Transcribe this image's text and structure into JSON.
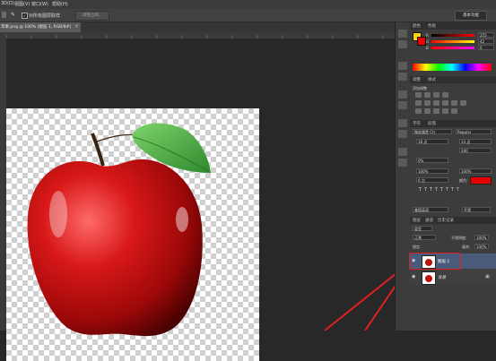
{
  "menubar": {
    "items": [
      "3D(D)",
      "视图(V)",
      "窗口(W)",
      "帮助(H)"
    ]
  },
  "optionsbar": {
    "sample_all_layers_label": "对所有图层取样",
    "refine_edge_label": "调整边缘...",
    "workspace_label": "基本功能"
  },
  "document": {
    "tab_title": "苹果.png @ 100% (图层 1, RGB/8#)"
  },
  "color_panel": {
    "tabs": [
      "颜色",
      "色板"
    ],
    "channels": [
      {
        "label": "R",
        "value": "255",
        "color": "#ff0000"
      },
      {
        "label": "G",
        "value": "42",
        "color": "#00ff00"
      },
      {
        "label": "B",
        "value": "0",
        "color": "#0000ff"
      }
    ],
    "fg_color": "#ffd200",
    "bg_color": "#e60000"
  },
  "adjust_panel": {
    "tabs": [
      "调整",
      "样式"
    ],
    "title": "添加调整"
  },
  "char_panel": {
    "tabs": [
      "字符",
      "段落"
    ],
    "font_family": "微软雅黑 Ctr",
    "font_style": "Regular",
    "font_size": "18 点",
    "leading": "14 点",
    "tracking": "200",
    "kerning": "0%",
    "vscale": "100%",
    "hscale": "100%",
    "baseline": "0 点",
    "color_label": "颜色:",
    "color": "#e60000",
    "lang_label": "美国英语",
    "aa_label": "平滑"
  },
  "layers_panel": {
    "tabs": [
      "图层",
      "通道",
      "历史记录"
    ],
    "kind_label": "类型",
    "blend_mode": "正常",
    "opacity_label": "不透明度:",
    "opacity_value": "100%",
    "lock_label": "锁定:",
    "fill_label": "填充:",
    "fill_value": "100%",
    "layers": [
      {
        "name": "图层 1",
        "selected": true
      },
      {
        "name": "背景",
        "selected": false
      }
    ]
  },
  "annotation": {
    "arrow_color": "#e02020"
  }
}
